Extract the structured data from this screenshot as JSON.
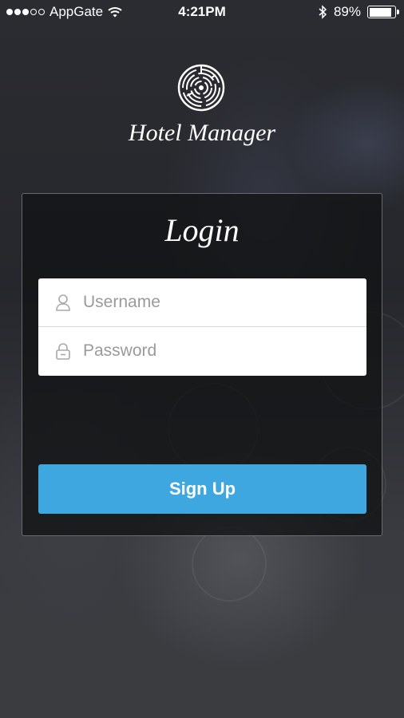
{
  "status_bar": {
    "carrier": "AppGate",
    "time": "4:21PM",
    "battery_percent": "89%",
    "battery_level": 0.89,
    "signal_bars_filled": 3,
    "signal_bars_total": 5
  },
  "app": {
    "title": "Hotel Manager",
    "logo_icon": "maze-circle-icon"
  },
  "login": {
    "title": "Login",
    "username_placeholder": "Username",
    "password_placeholder": "Password",
    "signup_label": "Sign Up"
  },
  "colors": {
    "accent": "#3fa7e0",
    "panel": "#121315"
  }
}
